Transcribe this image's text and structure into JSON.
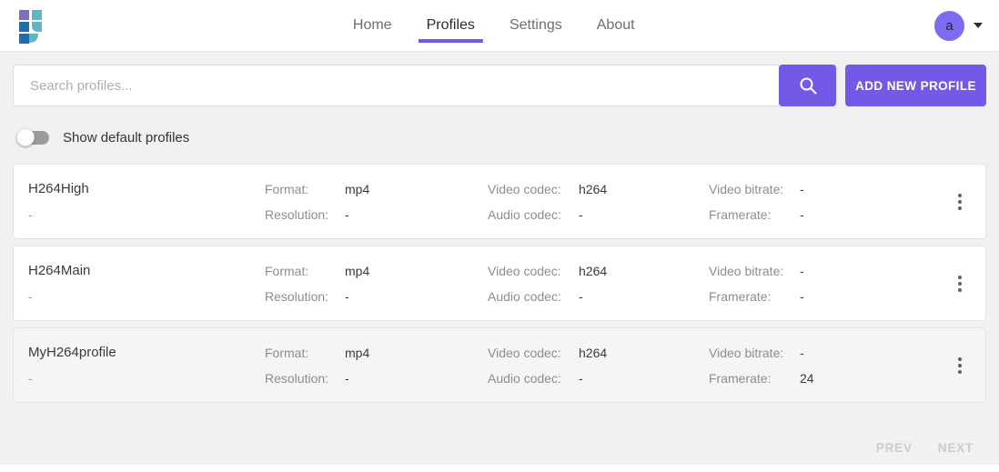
{
  "colors": {
    "primary": "#7458e8",
    "avatar_bg": "#7d6bf2",
    "logo_purple": "#7d6cc8",
    "logo_blue": "#1f6cb0",
    "logo_teal": "#5fb7c3",
    "page_bg": "#f1f1f1",
    "card_highlight_bg": "#f5f5f5"
  },
  "header": {
    "nav": [
      {
        "label": "Home",
        "active": false
      },
      {
        "label": "Profiles",
        "active": true
      },
      {
        "label": "Settings",
        "active": false
      },
      {
        "label": "About",
        "active": false
      }
    ],
    "avatar_initial": "a"
  },
  "search": {
    "placeholder": "Search profiles...",
    "add_button_label": "ADD NEW PROFILE"
  },
  "toggle": {
    "label": "Show default profiles",
    "state": "off"
  },
  "field_labels": {
    "format": "Format:",
    "resolution": "Resolution:",
    "video_codec": "Video codec:",
    "audio_codec": "Audio codec:",
    "video_bitrate": "Video bitrate:",
    "framerate": "Framerate:"
  },
  "profiles": [
    {
      "name": "H264High",
      "subtitle": "-",
      "highlighted": false,
      "fields": {
        "format": "mp4",
        "resolution": "-",
        "video_codec": "h264",
        "audio_codec": "-",
        "video_bitrate": "-",
        "framerate": "-"
      }
    },
    {
      "name": "H264Main",
      "subtitle": "-",
      "highlighted": false,
      "fields": {
        "format": "mp4",
        "resolution": "-",
        "video_codec": "h264",
        "audio_codec": "-",
        "video_bitrate": "-",
        "framerate": "-"
      }
    },
    {
      "name": "MyH264profile",
      "subtitle": "-",
      "highlighted": true,
      "fields": {
        "format": "mp4",
        "resolution": "-",
        "video_codec": "h264",
        "audio_codec": "-",
        "video_bitrate": "-",
        "framerate": "24"
      }
    }
  ],
  "pagination": {
    "prev": "PREV",
    "next": "NEXT"
  }
}
